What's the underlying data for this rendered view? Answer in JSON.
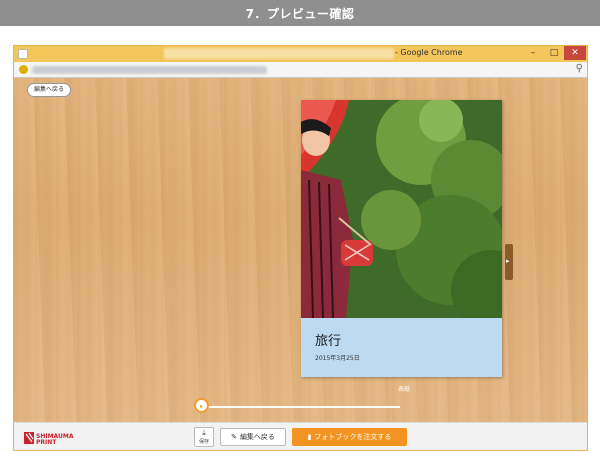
{
  "page_header": {
    "title": "7．プレビュー確認"
  },
  "browser": {
    "window_title_suffix": "- Google Chrome",
    "minimize_icon": "minimize-icon",
    "maximize_icon": "maximize-icon",
    "close_icon": "close-icon",
    "zoom_icon": "magnifier-icon"
  },
  "editor": {
    "back_button_label": "編集へ戻る",
    "cover": {
      "title": "旅行",
      "date": "2015年3月25日"
    },
    "page_label": "表紙",
    "slider": {
      "position": 0
    }
  },
  "footer": {
    "logo_top": "SHIMAUMA",
    "logo_bottom": "PRINT",
    "save_label": "保存",
    "edit_back_label": "編集へ戻る",
    "order_label": "フォトブックを注文する"
  },
  "colors": {
    "accent": "#f39422",
    "cover_panel": "#bcdaf1",
    "title_bar": "#f3c65c"
  }
}
